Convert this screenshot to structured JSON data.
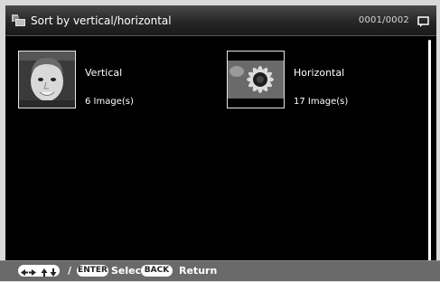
{
  "header": {
    "title": "Sort by vertical/horizontal",
    "page_counter": "0001/0002"
  },
  "items": [
    {
      "label": "Vertical",
      "count": "6 Image(s)"
    },
    {
      "label": "Horizontal",
      "count": "17 Image(s)"
    }
  ],
  "footer": {
    "separator": "/",
    "enter_label": "ENTER",
    "select_text": "Select",
    "back_label": "BACK",
    "return_text": "Return"
  },
  "icons": {
    "title": "sort-folder-icon",
    "top_right": "message-icon",
    "footer_nav": "arrow-keys-icon"
  },
  "colors": {
    "background": "#000000",
    "text": "#ffffff",
    "footer": "#6a6a6a"
  }
}
